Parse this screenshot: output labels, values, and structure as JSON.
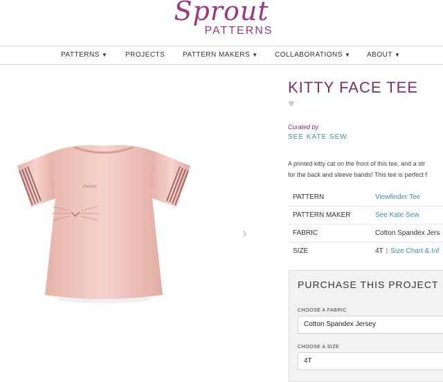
{
  "brand": {
    "script": "Sprout",
    "caps": "PATTERNS",
    "color": "#a03584"
  },
  "nav": [
    {
      "label": "PATTERNS",
      "dropdown": true
    },
    {
      "label": "PROJECTS",
      "dropdown": false
    },
    {
      "label": "PATTERN MAKERS",
      "dropdown": true
    },
    {
      "label": "COLLABORATIONS",
      "dropdown": true
    },
    {
      "label": "ABOUT",
      "dropdown": true
    }
  ],
  "product": {
    "title": "KITTY FACE TEE",
    "curated_by_label": "Curated by",
    "curator_link": "SEE KATE SEW",
    "description_lines": [
      "A printed kitty cat on the front of this tee, and a str",
      "for the back and sleeve bands! This tee is perfect f"
    ],
    "specs": [
      {
        "key": "PATTERN",
        "value": "Viewfinder Tee",
        "link": true
      },
      {
        "key": "PATTERN MAKER",
        "value": "See Kate Sew",
        "link": true
      },
      {
        "key": "FABRIC",
        "value": "Cotton Spandex Jers",
        "link": false
      },
      {
        "key": "SIZE",
        "value": "4T",
        "link": false,
        "extra_link": "Size Chart & Inf",
        "separator": "|"
      }
    ]
  },
  "purchase": {
    "title": "PURCHASE THIS PROJECT",
    "fabric_label": "CHOOSE A FABRIC",
    "fabric_value": "Cotton Spandex Jersey",
    "size_label": "CHOOSE A SIZE",
    "size_value": "4T"
  },
  "colors": {
    "title": "#7a2e6b",
    "link": "#3b8fa8",
    "shirt": "#f2c8bf"
  }
}
